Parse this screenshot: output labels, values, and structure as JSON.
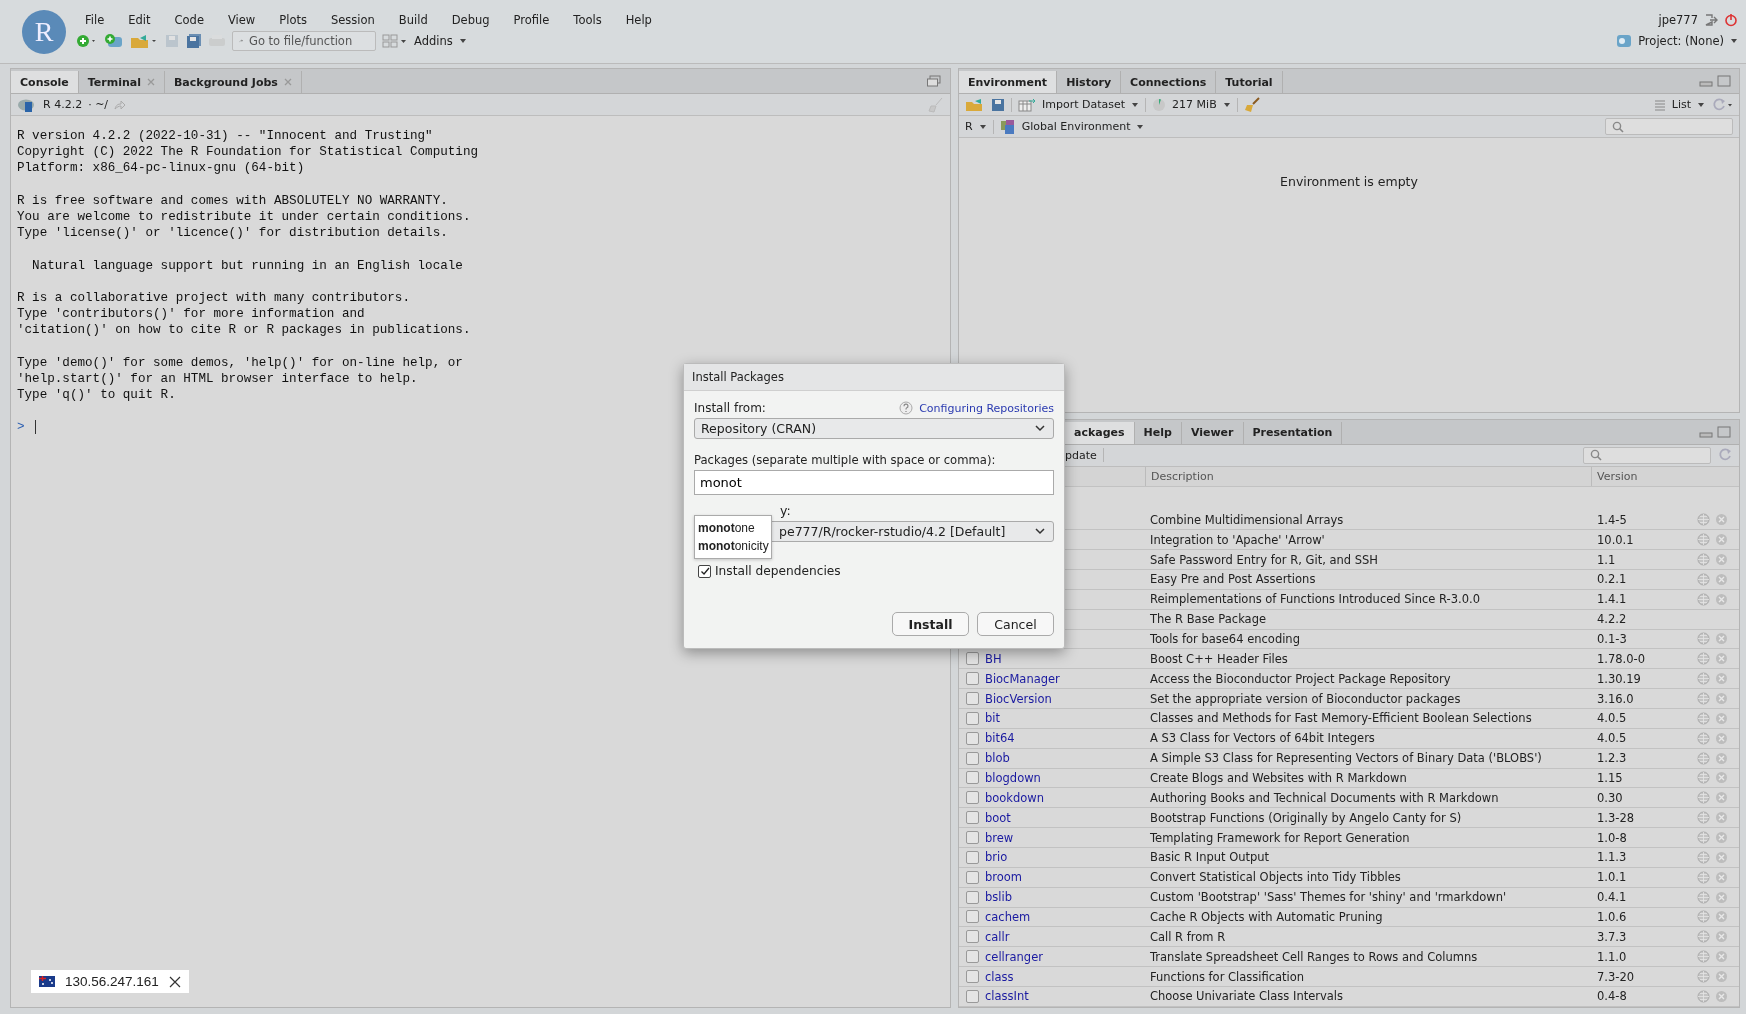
{
  "menubar": {
    "logo": "R",
    "menus": [
      "File",
      "Edit",
      "Code",
      "View",
      "Plots",
      "Session",
      "Build",
      "Debug",
      "Profile",
      "Tools",
      "Help"
    ],
    "user": "jpe777"
  },
  "toolbar": {
    "goto_placeholder": "Go to file/function",
    "addins": "Addins",
    "project": "Project: (None)"
  },
  "console": {
    "tabs": [
      {
        "label": "Console",
        "selected": true,
        "closable": false
      },
      {
        "label": "Terminal",
        "selected": false,
        "closable": true
      },
      {
        "label": "Background Jobs",
        "selected": false,
        "closable": true
      }
    ],
    "version": "R 4.2.2",
    "path": "· ~/",
    "paragraphs": [
      [
        "R version 4.2.2 (2022-10-31) -- \"Innocent and Trusting\"",
        "Copyright (C) 2022 The R Foundation for Statistical Computing",
        "Platform: x86_64-pc-linux-gnu (64-bit)"
      ],
      [
        "R is free software and comes with ABSOLUTELY NO WARRANTY.",
        "You are welcome to redistribute it under certain conditions.",
        "Type 'license()' or 'licence()' for distribution details."
      ],
      [
        "  Natural language support but running in an English locale"
      ],
      [
        "R is a collaborative project with many contributors.",
        "Type 'contributors()' for more information and",
        "'citation()' on how to cite R or R packages in publications."
      ],
      [
        "Type 'demo()' for some demos, 'help()' for on-line help, or",
        "'help.start()' for an HTML browser interface to help.",
        "Type 'q()' to quit R."
      ]
    ],
    "prompt": ">"
  },
  "environment": {
    "tabs": [
      {
        "label": "Environment",
        "selected": true
      },
      {
        "label": "History",
        "selected": false
      },
      {
        "label": "Connections",
        "selected": false
      },
      {
        "label": "Tutorial",
        "selected": false
      }
    ],
    "import": "Import Dataset",
    "memory": "217 MiB",
    "view": "List",
    "language": "R",
    "scope": "Global Environment",
    "empty_message": "Environment is empty"
  },
  "packages": {
    "tabs": [
      {
        "label": "ackages",
        "selected": true
      },
      {
        "label": "Help",
        "selected": false
      },
      {
        "label": "Viewer",
        "selected": false
      },
      {
        "label": "Presentation",
        "selected": false
      }
    ],
    "update": "pdate",
    "columns": [
      "Description",
      "Version"
    ],
    "rows": [
      {
        "description": "Combine Multidimensional Arrays",
        "version": "1.4-5",
        "actions": true
      },
      {
        "description": "Integration to 'Apache' 'Arrow'",
        "version": "10.0.1",
        "actions": true
      },
      {
        "description": "Safe Password Entry for R, Git, and SSH",
        "version": "1.1",
        "actions": true
      },
      {
        "description": "Easy Pre and Post Assertions",
        "version": "0.2.1",
        "actions": true
      },
      {
        "description": "Reimplementations of Functions Introduced Since R-3.0.0",
        "version": "1.4.1",
        "actions": true
      },
      {
        "description": "The R Base Package",
        "version": "4.2.2",
        "actions": false
      },
      {
        "description": "Tools for base64 encoding",
        "version": "0.1-3",
        "actions": true
      },
      {
        "name": "BH",
        "checked": false,
        "description": "Boost C++ Header Files",
        "version": "1.78.0-0",
        "actions": true
      },
      {
        "name": "BiocManager",
        "checked": false,
        "description": "Access the Bioconductor Project Package Repository",
        "version": "1.30.19",
        "actions": true
      },
      {
        "name": "BiocVersion",
        "checked": false,
        "description": "Set the appropriate version of Bioconductor packages",
        "version": "3.16.0",
        "actions": true
      },
      {
        "name": "bit",
        "checked": false,
        "description": "Classes and Methods for Fast Memory-Efficient Boolean Selections",
        "version": "4.0.5",
        "actions": true
      },
      {
        "name": "bit64",
        "checked": false,
        "description": "A S3 Class for Vectors of 64bit Integers",
        "version": "4.0.5",
        "actions": true
      },
      {
        "name": "blob",
        "checked": false,
        "description": "A Simple S3 Class for Representing Vectors of Binary Data ('BLOBS')",
        "version": "1.2.3",
        "actions": true
      },
      {
        "name": "blogdown",
        "checked": false,
        "description": "Create Blogs and Websites with R Markdown",
        "version": "1.15",
        "actions": true
      },
      {
        "name": "bookdown",
        "checked": false,
        "description": "Authoring Books and Technical Documents with R Markdown",
        "version": "0.30",
        "actions": true
      },
      {
        "name": "boot",
        "checked": false,
        "description": "Bootstrap Functions (Originally by Angelo Canty for S)",
        "version": "1.3-28",
        "actions": true
      },
      {
        "name": "brew",
        "checked": false,
        "description": "Templating Framework for Report Generation",
        "version": "1.0-8",
        "actions": true
      },
      {
        "name": "brio",
        "checked": false,
        "description": "Basic R Input Output",
        "version": "1.1.3",
        "actions": true
      },
      {
        "name": "broom",
        "checked": false,
        "description": "Convert Statistical Objects into Tidy Tibbles",
        "version": "1.0.1",
        "actions": true
      },
      {
        "name": "bslib",
        "checked": false,
        "description": "Custom 'Bootstrap' 'Sass' Themes for 'shiny' and 'rmarkdown'",
        "version": "0.4.1",
        "actions": true
      },
      {
        "name": "cachem",
        "checked": false,
        "description": "Cache R Objects with Automatic Pruning",
        "version": "1.0.6",
        "actions": true
      },
      {
        "name": "callr",
        "checked": false,
        "description": "Call R from R",
        "version": "3.7.3",
        "actions": true
      },
      {
        "name": "cellranger",
        "checked": false,
        "description": "Translate Spreadsheet Cell Ranges to Rows and Columns",
        "version": "1.1.0",
        "actions": true
      },
      {
        "name": "class",
        "checked": false,
        "description": "Functions for Classification",
        "version": "7.3-20",
        "actions": true
      },
      {
        "name": "classInt",
        "checked": false,
        "description": "Choose Univariate Class Intervals",
        "version": "0.4-8",
        "actions": true
      }
    ]
  },
  "dialog": {
    "title": "Install Packages",
    "from_label": "Install from:",
    "help_link": "Configuring Repositories",
    "from_value": "Repository (CRAN)",
    "packages_label": "Packages (separate multiple with space or comma):",
    "packages_value": "monot",
    "suggestions": [
      "**monot**one",
      "**monot**onicity"
    ],
    "library_label": "y:",
    "library_value": "pe777/R/rocker-rstudio/4.2 [Default]",
    "dependencies": {
      "label": "Install dependencies",
      "checked": true
    },
    "buttons": [
      "Install",
      "Cancel"
    ]
  },
  "ip_badge": {
    "text": "130.56.247.161"
  }
}
